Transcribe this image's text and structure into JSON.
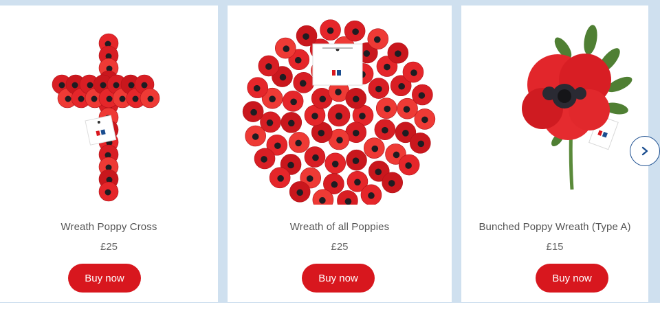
{
  "products": [
    {
      "name": "Wreath Poppy Cross",
      "price": "£25",
      "button": "Buy now",
      "image": "poppy-cross-image"
    },
    {
      "name": "Wreath of all Poppies",
      "price": "£25",
      "button": "Buy now",
      "image": "round-poppy-wreath-image"
    },
    {
      "name": "Bunched Poppy Wreath (Type A)",
      "price": "£15",
      "button": "Buy now",
      "image": "bunched-poppy-image"
    }
  ],
  "carousel": {
    "next_icon": "chevron-right-icon"
  },
  "colors": {
    "accent_red": "#d8171e",
    "poppy_red": "#e5262a",
    "background_blue": "#cfe0ef",
    "arrow_blue": "#1a4d8f",
    "leaf_green": "#5a8a3a"
  }
}
